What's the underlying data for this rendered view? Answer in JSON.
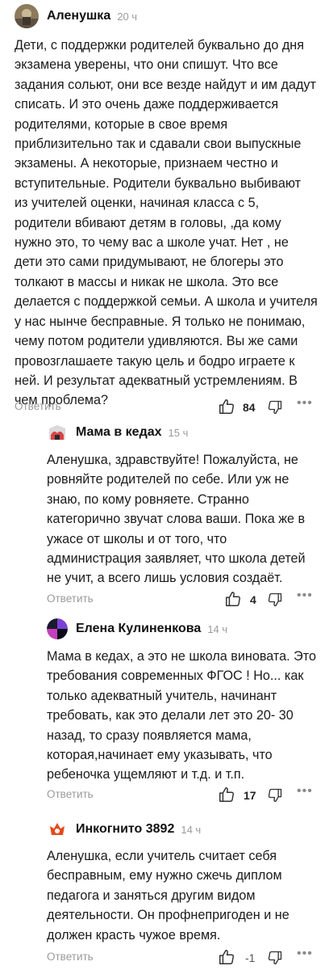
{
  "comments": [
    {
      "author": "Аленушка",
      "time": "20 ч",
      "text": "Дети, с поддержки родителей буквально до дня экзамена уверены, что они спишут. Что все задания сольют, они все везде найдут и им дадут списать. И это очень даже поддерживается родителями, которые в свое время приблизительно так и сдавали свои выпускные экзамены. А некоторые, признаем честно и вступительные. Родители буквально выбивают из учителей оценки, начиная класса с 5, родители вбивают детям в головы, ,да кому нужно это, то чему вас а школе учат. Нет , не дети это сами придумывают, не блогеры это толкают в массы и никак не школа. Это все делается с поддержкой семьи. А школа и учителя у нас нынче бесправные. Я только не понимаю, чему потом родители удивляются. Вы же сами провозглашаете такую цель и бодро играете к ней. И результат адекватный устремлениям. В чем проблема?",
      "reply_label": "Ответить",
      "likes": "84",
      "more": "•••"
    },
    {
      "author": "Мама в кедах",
      "time": "15 ч",
      "text": "Аленушка, здравствуйте! Пожалуйста, не ровняйте родителей по себе. Или уж не знаю, по кому ровняете. Странно категорично звучат слова ваши. Пока же в ужасе от школы и от того, что администрация заявляет, что школа детей не учит, а всего лишь условия создаёт.",
      "reply_label": "Ответить",
      "likes": "4",
      "more": "•••"
    },
    {
      "author": "Елена Кулиненкова",
      "time": "14 ч",
      "text": "Мама в кедах, а это не школа виновата. Это требования современных ФГОС ! Но... как только адекватный учитель, начинант требовать, как это делали лет это 20- 30 назад, то сразу появляется мама, которая,начинает ему указывать, что ребеночка ущемляют и т.д. и т.п.",
      "reply_label": "Ответить",
      "likes": "17",
      "more": "•••"
    },
    {
      "author": "Инкогнито 3892",
      "time": "14 ч",
      "text": "Аленушка, если учитель считает себя бесправным, ему нужно сжечь диплом педагога и заняться другим видом деятельности. Он профнепригоден и не должен красть чужое время.",
      "reply_label": "Ответить",
      "likes": "-1",
      "more": "•••"
    }
  ]
}
